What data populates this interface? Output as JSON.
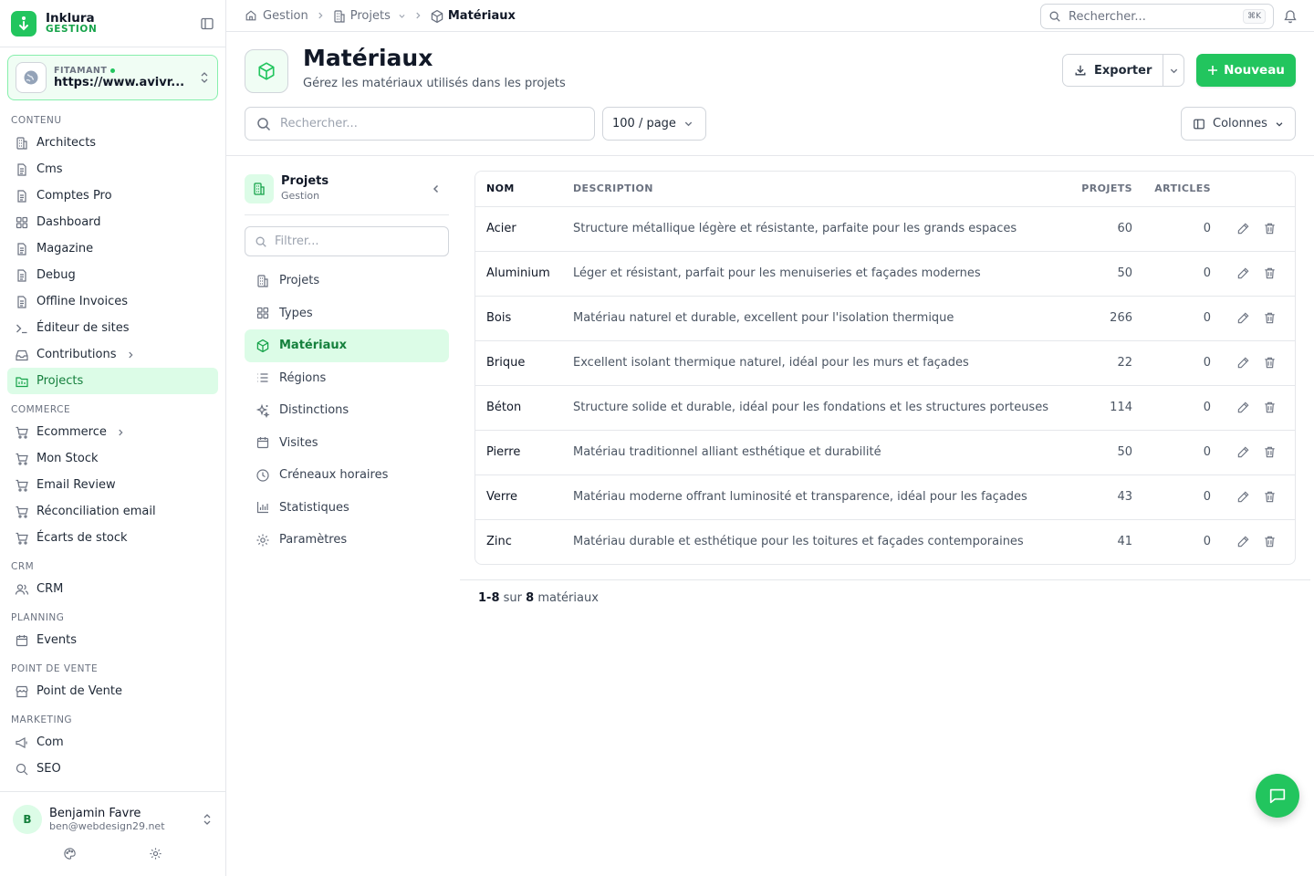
{
  "brand": {
    "name": "Inklura",
    "sub": "GESTION"
  },
  "site": {
    "label": "FITAMANT",
    "url": "https://www.avivr..."
  },
  "sidebar": {
    "sections": [
      {
        "title": "CONTENU",
        "items": [
          {
            "label": "Architects",
            "icon": "building-icon"
          },
          {
            "label": "Cms",
            "icon": "file-icon"
          },
          {
            "label": "Comptes Pro",
            "icon": "file-icon"
          },
          {
            "label": "Dashboard",
            "icon": "grid-icon"
          },
          {
            "label": "Magazine",
            "icon": "file-icon"
          },
          {
            "label": "Debug",
            "icon": "file-icon"
          },
          {
            "label": "Offline Invoices",
            "icon": "file-icon"
          },
          {
            "label": "Éditeur de sites",
            "icon": "terminal-icon"
          },
          {
            "label": "Contributions",
            "icon": "inbox-icon",
            "has_children": true
          },
          {
            "label": "Projects",
            "icon": "folder-icon",
            "active": true
          }
        ]
      },
      {
        "title": "COMMERCE",
        "items": [
          {
            "label": "Ecommerce",
            "icon": "cart-icon",
            "has_children": true
          },
          {
            "label": "Mon Stock",
            "icon": "cart-icon"
          },
          {
            "label": "Email Review",
            "icon": "cart-icon"
          },
          {
            "label": "Réconciliation email",
            "icon": "cart-icon"
          },
          {
            "label": "Écarts de stock",
            "icon": "cart-icon"
          }
        ]
      },
      {
        "title": "CRM",
        "items": [
          {
            "label": "CRM",
            "icon": "users-icon"
          }
        ]
      },
      {
        "title": "PLANNING",
        "items": [
          {
            "label": "Events",
            "icon": "calendar-icon"
          }
        ]
      },
      {
        "title": "POINT DE VENTE",
        "items": [
          {
            "label": "Point de Vente",
            "icon": "store-icon"
          }
        ]
      },
      {
        "title": "MARKETING",
        "items": [
          {
            "label": "Com",
            "icon": "megaphone-icon"
          },
          {
            "label": "SEO",
            "icon": "search-icon"
          }
        ]
      }
    ]
  },
  "user": {
    "initial": "B",
    "name": "Benjamin Favre",
    "email": "ben@webdesign29.net"
  },
  "breadcrumb": [
    {
      "label": "Gestion",
      "icon": "home-icon"
    },
    {
      "label": "Projets",
      "icon": "building-icon",
      "dropdown": true
    },
    {
      "label": "Matériaux",
      "icon": "box-icon",
      "current": true
    }
  ],
  "top_search": {
    "placeholder": "Rechercher...",
    "shortcut": "⌘K"
  },
  "header": {
    "title": "Matériaux",
    "subtitle": "Gérez les matériaux utilisés dans les projets",
    "export_label": "Exporter",
    "new_label": "Nouveau",
    "search_placeholder": "Rechercher...",
    "per_page": "100 / page",
    "columns_label": "Colonnes"
  },
  "subnav": {
    "title": "Projets",
    "subtitle": "Gestion",
    "filter_placeholder": "Filtrer...",
    "items": [
      {
        "label": "Projets",
        "icon": "building-icon"
      },
      {
        "label": "Types",
        "icon": "grid-icon"
      },
      {
        "label": "Matériaux",
        "icon": "box-icon",
        "active": true
      },
      {
        "label": "Régions",
        "icon": "list-icon"
      },
      {
        "label": "Distinctions",
        "icon": "sparkles-icon"
      },
      {
        "label": "Visites",
        "icon": "calendar-icon"
      },
      {
        "label": "Créneaux horaires",
        "icon": "clock-icon"
      },
      {
        "label": "Statistiques",
        "icon": "chart-icon"
      },
      {
        "label": "Paramètres",
        "icon": "gear-icon"
      }
    ]
  },
  "table": {
    "columns": [
      "NOM",
      "DESCRIPTION",
      "PROJETS",
      "ARTICLES"
    ],
    "rows": [
      {
        "name": "Acier",
        "description": "Structure métallique légère et résistante, parfaite pour les grands espaces",
        "projets": "60",
        "articles": "0"
      },
      {
        "name": "Aluminium",
        "description": "Léger et résistant, parfait pour les menuiseries et façades modernes",
        "projets": "50",
        "articles": "0"
      },
      {
        "name": "Bois",
        "description": "Matériau naturel et durable, excellent pour l'isolation thermique",
        "projets": "266",
        "articles": "0"
      },
      {
        "name": "Brique",
        "description": "Excellent isolant thermique naturel, idéal pour les murs et façades",
        "projets": "22",
        "articles": "0"
      },
      {
        "name": "Béton",
        "description": "Structure solide et durable, idéal pour les fondations et les structures porteuses",
        "projets": "114",
        "articles": "0"
      },
      {
        "name": "Pierre",
        "description": "Matériau traditionnel alliant esthétique et durabilité",
        "projets": "50",
        "articles": "0"
      },
      {
        "name": "Verre",
        "description": "Matériau moderne offrant luminosité et transparence, idéal pour les façades",
        "projets": "43",
        "articles": "0"
      },
      {
        "name": "Zinc",
        "description": "Matériau durable et esthétique pour les toitures et façades contemporaines",
        "projets": "41",
        "articles": "0"
      }
    ]
  },
  "footer": {
    "range": "1-8",
    "sep": "sur",
    "total": "8",
    "unit": "matériaux"
  },
  "colors": {
    "accent": "#22c55e",
    "accent_bg": "#dcfce7",
    "accent_text": "#15803d"
  }
}
